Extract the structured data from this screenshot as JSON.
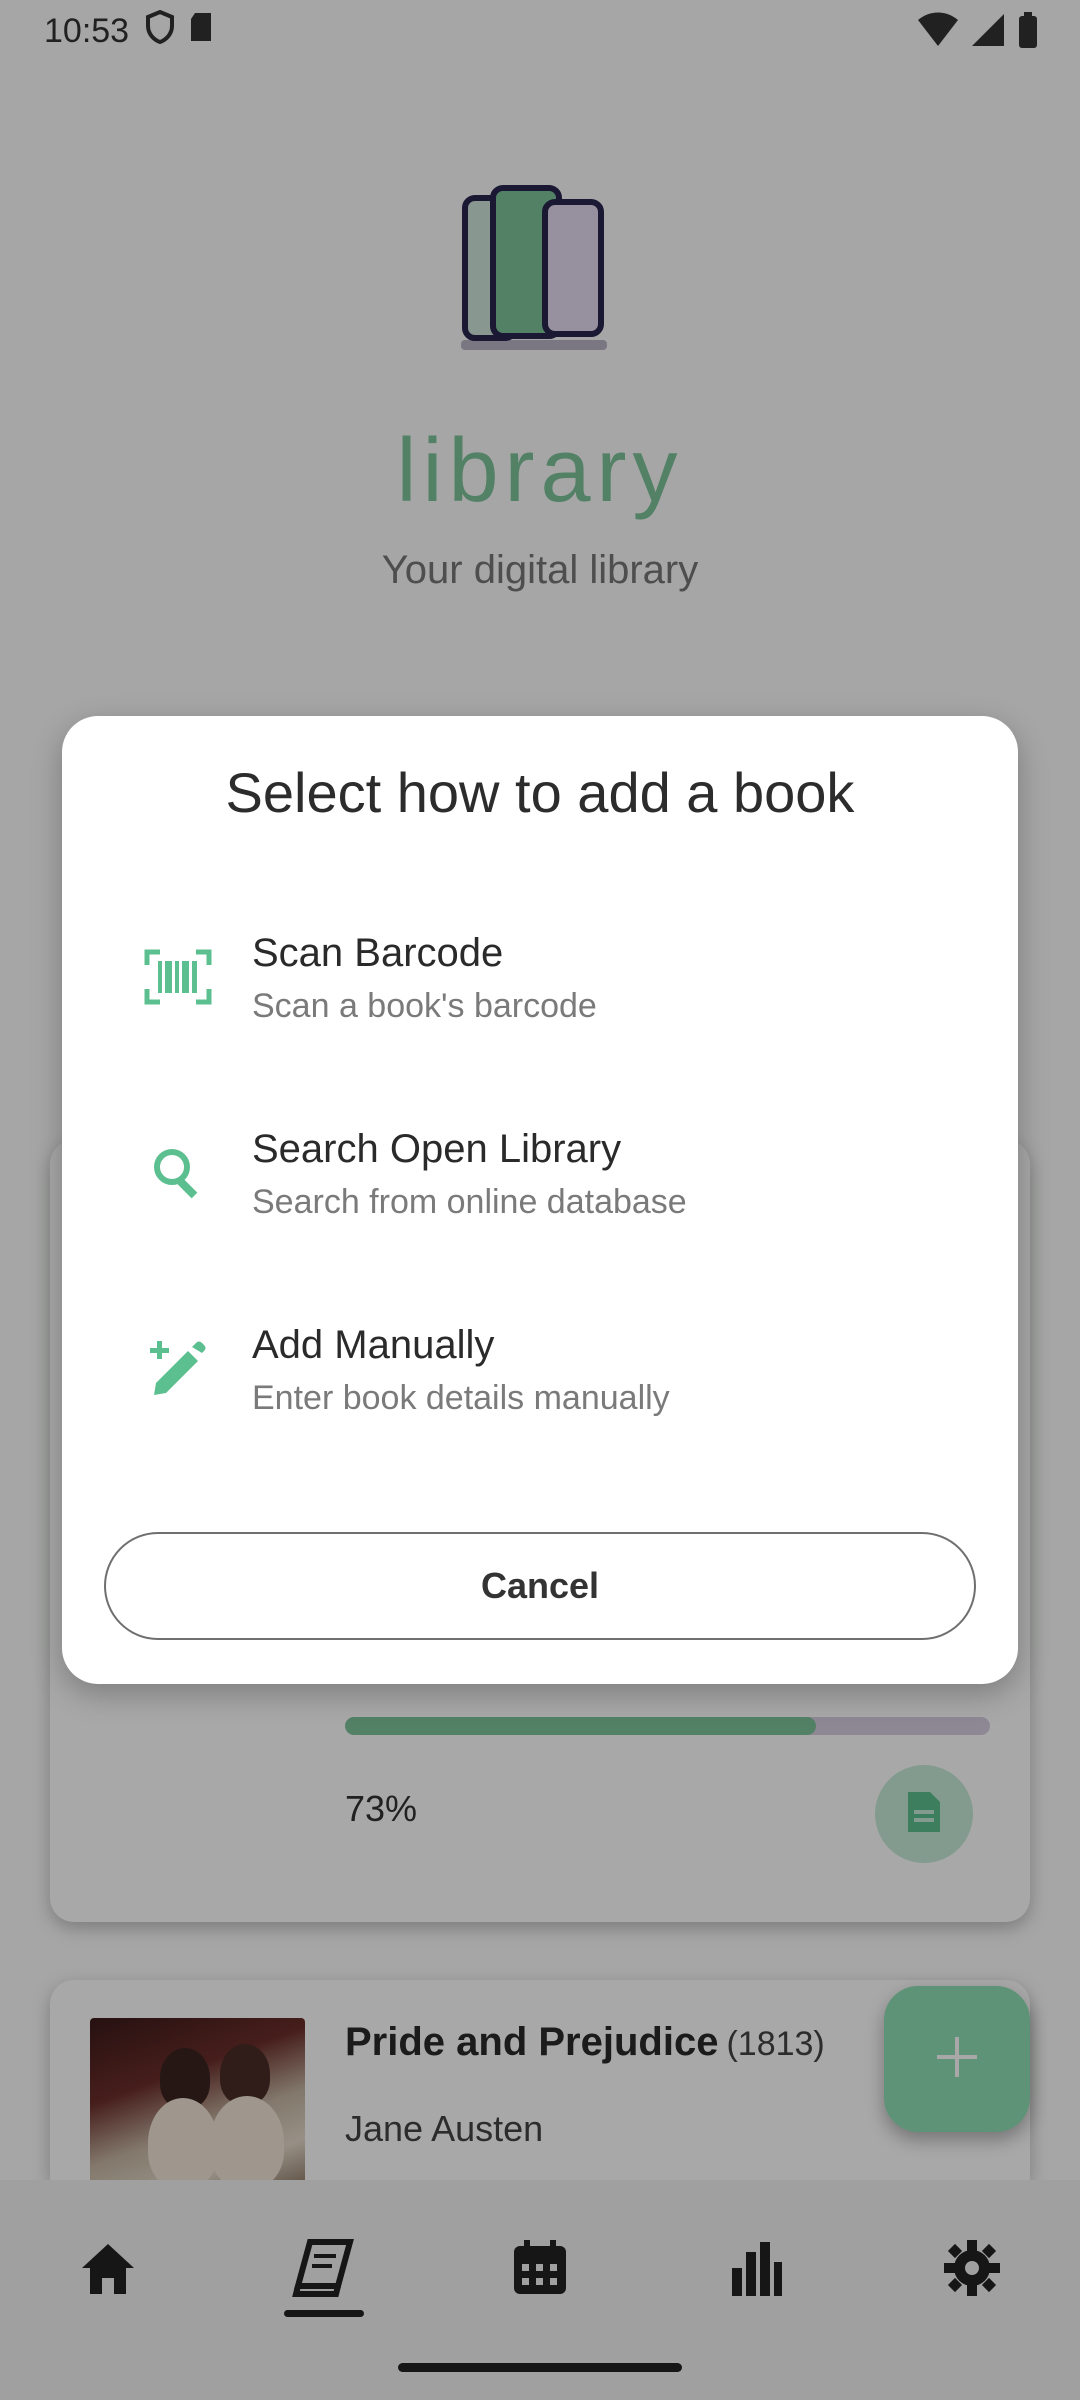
{
  "status_bar": {
    "time": "10:53"
  },
  "header": {
    "app_title": "library",
    "subtitle": "Your digital library"
  },
  "current_book": {
    "progress_percent": 73,
    "progress_label": "73%"
  },
  "book_list": [
    {
      "title": "Pride and Prejudice",
      "year": "(1813)",
      "author": "Jane Austen"
    }
  ],
  "dialog": {
    "title": "Select how to add a book",
    "options": [
      {
        "title": "Scan Barcode",
        "subtitle": "Scan a book's barcode",
        "icon": "barcode-scan-icon"
      },
      {
        "title": "Search Open Library",
        "subtitle": "Search from online database",
        "icon": "search-icon"
      },
      {
        "title": "Add Manually",
        "subtitle": "Enter book details manually",
        "icon": "pencil-plus-icon"
      }
    ],
    "cancel_label": "Cancel"
  },
  "bottom_nav": {
    "items": [
      "home-icon",
      "book-icon",
      "calendar-icon",
      "stats-icon",
      "gear-icon"
    ],
    "selected": "book-icon"
  },
  "colors": {
    "accent": "#7dc49c",
    "fab": "#8fe0b6",
    "progress_track": "#d8cfe3",
    "icon_green": "#5cbf8f"
  }
}
